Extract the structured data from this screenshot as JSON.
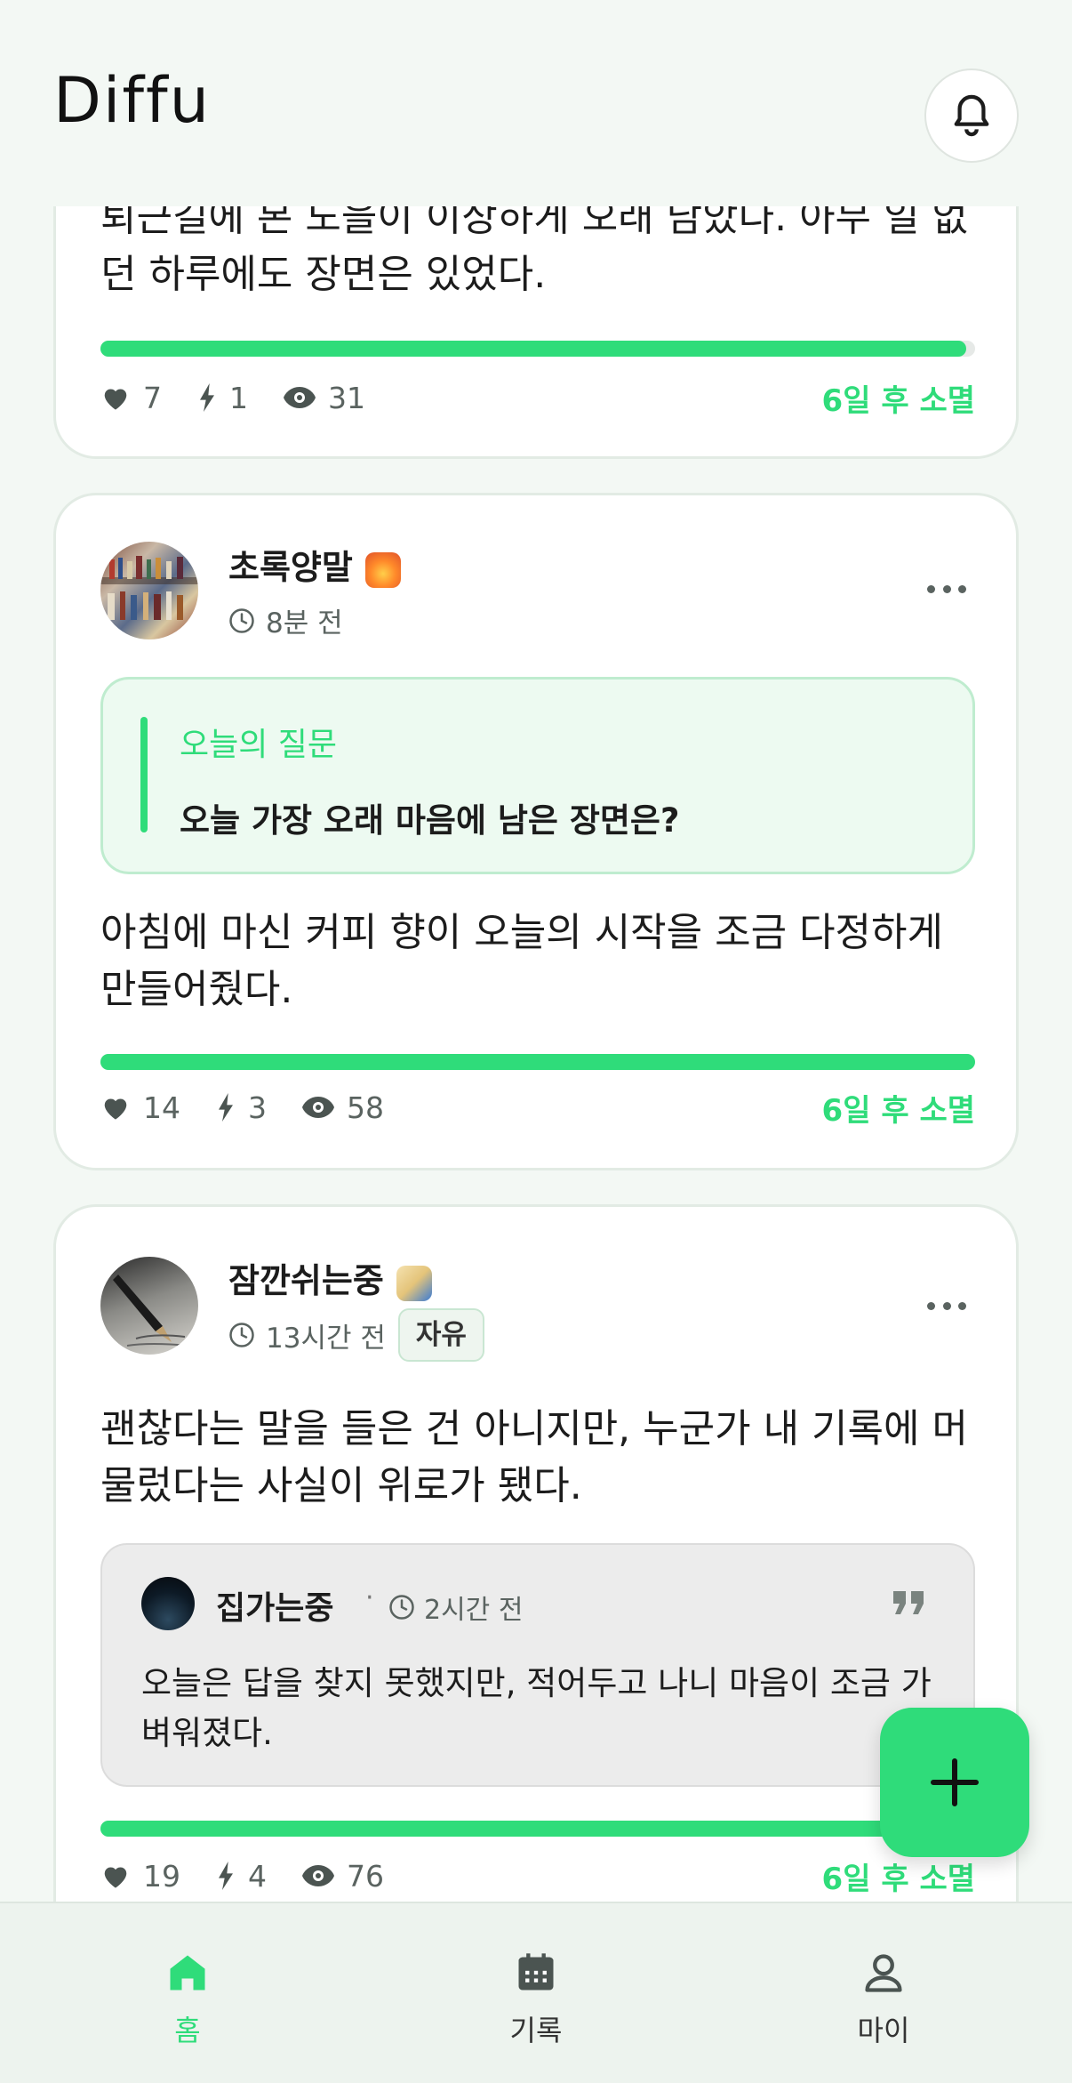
{
  "app": {
    "title": "Diffu"
  },
  "posts": [
    {
      "text": "퇴근길에 본 노을이 이상하게 오래 남았다. 아무 일 없던 하루에도 장면은 있었다.",
      "progress": 0.99,
      "likes": "7",
      "boosts": "1",
      "views": "31",
      "expire": "6일 후 소멸"
    },
    {
      "username": "초록양말",
      "time": "8분 전",
      "question_label": "오늘의 질문",
      "question": "오늘 가장 오래 마음에 남은 장면은?",
      "text": "아침에 마신 커피 향이 오늘의 시작을 조금 다정하게 만들어줬다.",
      "progress": 1.0,
      "likes": "14",
      "boosts": "3",
      "views": "58",
      "expire": "6일 후 소멸"
    },
    {
      "username": "잠깐쉬는중",
      "time": "13시간 전",
      "tag": "자유",
      "text": "괜찮다는 말을 들은 건 아니지만, 누군가 내 기록에 머물렀다는 사실이 위로가 됐다.",
      "reply": {
        "username": "집가는중",
        "separator": "·",
        "time": "2시간 전",
        "text": "오늘은 답을 찾지 못했지만, 적어두고 나니 마음이 조금 가벼워졌다."
      },
      "progress": 1.0,
      "likes": "19",
      "boosts": "4",
      "views": "76",
      "expire": "6일 후 소멸"
    }
  ],
  "tabs": [
    {
      "label": "홈",
      "icon": "home-icon",
      "active": true
    },
    {
      "label": "기록",
      "icon": "calendar-icon",
      "active": false
    },
    {
      "label": "마이",
      "icon": "person-icon",
      "active": false
    }
  ],
  "colors": {
    "accent": "#2fdc7a",
    "background": "#f3f8f4",
    "card": "#ffffff"
  }
}
